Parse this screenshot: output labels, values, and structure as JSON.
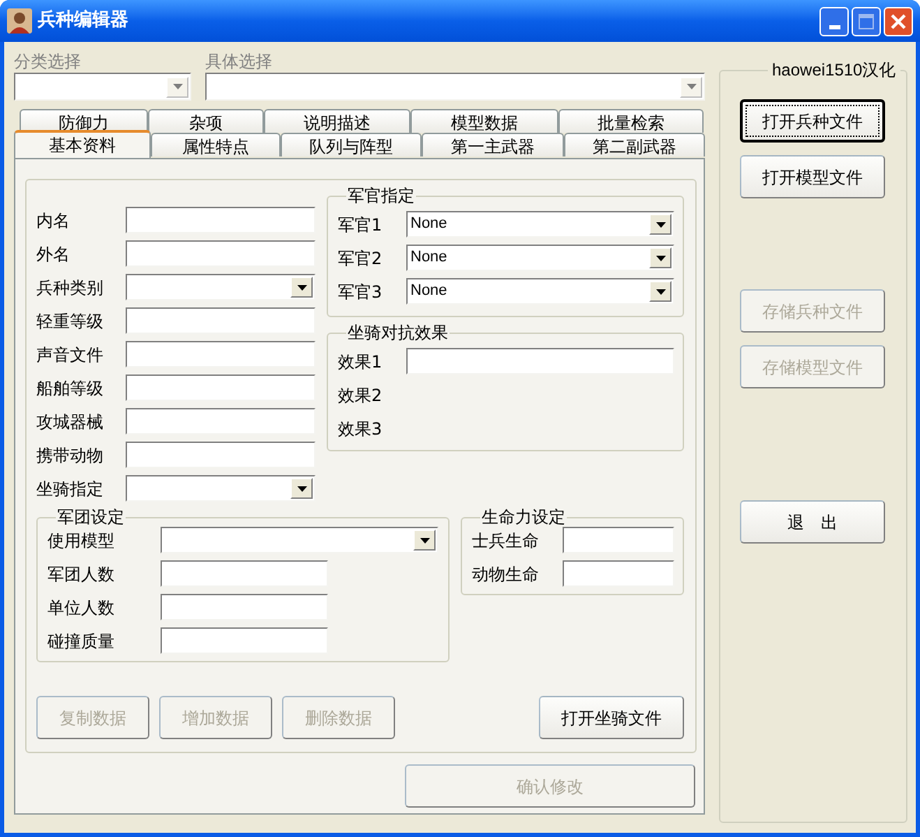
{
  "window": {
    "title": "兵种编辑器"
  },
  "selectors": [
    {
      "label": "分类选择",
      "kind": "short"
    },
    {
      "label": "具体选择",
      "kind": "long"
    }
  ],
  "tab_rows": [
    {
      "tabs": [
        {
          "label": "防御力",
          "selected": false
        },
        {
          "label": "杂项",
          "selected": false
        },
        {
          "label": "说明描述",
          "selected": false
        },
        {
          "label": "模型数据",
          "selected": false
        },
        {
          "label": "批量检索",
          "selected": false
        }
      ]
    },
    {
      "tabs": [
        {
          "label": "基本资料",
          "selected": true
        },
        {
          "label": "属性特点",
          "selected": false
        },
        {
          "label": "队列与阵型",
          "selected": false
        },
        {
          "label": "第一主武器",
          "selected": false
        },
        {
          "label": "第二副武器",
          "selected": false
        }
      ]
    }
  ],
  "basic_fields": [
    {
      "label": "内名",
      "kind": "text"
    },
    {
      "label": "外名",
      "kind": "text"
    },
    {
      "label": "兵种类别",
      "kind": "dropdown"
    },
    {
      "label": "轻重等级",
      "kind": "text"
    },
    {
      "label": "声音文件",
      "kind": "text"
    },
    {
      "label": "船舶等级",
      "kind": "text"
    },
    {
      "label": "攻城器械",
      "kind": "text"
    },
    {
      "label": "携带动物",
      "kind": "text"
    },
    {
      "label": "坐骑指定",
      "kind": "dropdown"
    }
  ],
  "officers": {
    "title": "军官指定",
    "rows": [
      {
        "label": "军官1",
        "value": "None"
      },
      {
        "label": "军官2",
        "value": "None"
      },
      {
        "label": "军官3",
        "value": "None"
      }
    ]
  },
  "mount_effects": {
    "title": "坐骑对抗效果",
    "rows": [
      {
        "label": "效果1",
        "kind": "text"
      },
      {
        "label": "效果2",
        "kind": "label"
      },
      {
        "label": "效果3",
        "kind": "label"
      }
    ]
  },
  "legion": {
    "title": "军团设定",
    "fields": [
      {
        "label": "使用模型",
        "kind": "dropdown"
      },
      {
        "label": "军团人数",
        "kind": "text"
      },
      {
        "label": "单位人数",
        "kind": "text"
      },
      {
        "label": "碰撞质量",
        "kind": "text"
      }
    ]
  },
  "vitality": {
    "title": "生命力设定",
    "fields": [
      {
        "label": "士兵生命"
      },
      {
        "label": "动物生命"
      }
    ]
  },
  "data_buttons": [
    {
      "label": "复制数据",
      "disabled": true
    },
    {
      "label": "增加数据",
      "disabled": true
    },
    {
      "label": "删除数据",
      "disabled": true
    }
  ],
  "mount_button": {
    "label": "打开坐骑文件",
    "disabled": false
  },
  "confirm_button": {
    "label": "确认修改",
    "disabled": true
  },
  "side_panel": {
    "title": "haowei1510汉化",
    "buttons": [
      {
        "label": "打开兵种文件",
        "disabled": false,
        "focused": true
      },
      {
        "label": "打开模型文件",
        "disabled": false,
        "focused": false
      },
      {
        "label": "存储兵种文件",
        "disabled": true,
        "focused": false
      },
      {
        "label": "存储模型文件",
        "disabled": true,
        "focused": false
      },
      {
        "label": "退　出",
        "disabled": false,
        "focused": false
      }
    ]
  }
}
